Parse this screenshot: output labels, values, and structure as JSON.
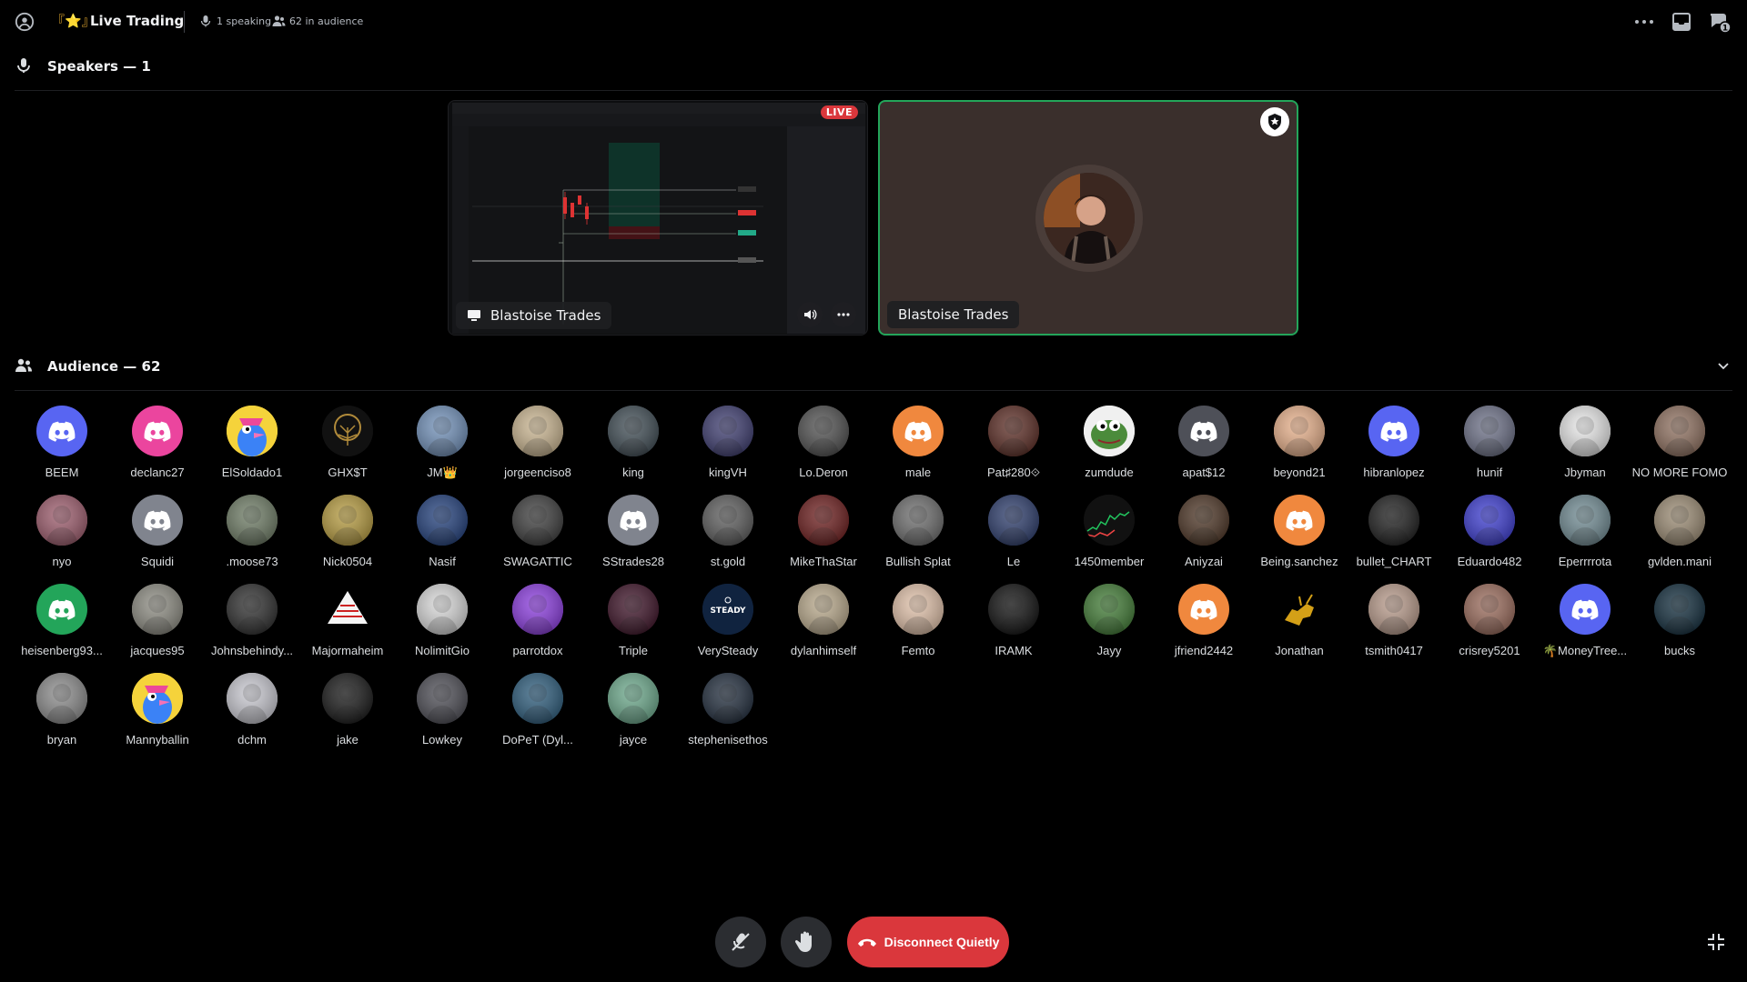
{
  "header": {
    "title_emoji": "『⭐』",
    "title": "Live Trading",
    "speaking_text": "1 speaking",
    "audience_text": "62 in audience"
  },
  "speakers": {
    "label": "Speakers — 1",
    "tiles": [
      {
        "name": "Blastoise Trades",
        "type": "screenshare",
        "badge": "LIVE"
      },
      {
        "name": "Blastoise Trades",
        "type": "camera"
      }
    ]
  },
  "audience": {
    "label": "Audience — 62",
    "members": [
      {
        "name": "BEEM",
        "avatar": "discord-icon",
        "color": "#5865f2"
      },
      {
        "name": "declanc27",
        "avatar": "discord-icon",
        "color": "#eb459e"
      },
      {
        "name": "ElSoldado1",
        "avatar": "blue-bird",
        "color": "#f5d33b"
      },
      {
        "name": "GHX$T",
        "avatar": "tree",
        "color": "#111111"
      },
      {
        "name": "JM👑",
        "avatar": "photo",
        "color": "#6f8fb8"
      },
      {
        "name": "jorgeenciso8",
        "avatar": "photo",
        "color": "#c9b48f"
      },
      {
        "name": "king",
        "avatar": "photo",
        "color": "#3d4a52"
      },
      {
        "name": "kingVH",
        "avatar": "photo",
        "color": "#3b3a6e"
      },
      {
        "name": "Lo.Deron",
        "avatar": "photo",
        "color": "#4d4d4d"
      },
      {
        "name": "male",
        "avatar": "discord-icon",
        "color": "#f0883e"
      },
      {
        "name": "Pat♯280⟐",
        "avatar": "photo",
        "color": "#5a2a22"
      },
      {
        "name": "zumdude",
        "avatar": "frog",
        "color": "#f0f0f0"
      },
      {
        "name": "apat$12",
        "avatar": "discord-icon",
        "color": "#4e5058"
      },
      {
        "name": "beyond21",
        "avatar": "photo",
        "color": "#e8b08a"
      },
      {
        "name": "hibranlopez",
        "avatar": "discord-icon",
        "color": "#5865f2"
      },
      {
        "name": "hunif",
        "avatar": "photo",
        "color": "#6b6f86"
      },
      {
        "name": "Jbyman",
        "avatar": "photo",
        "color": "#e9e9e9"
      },
      {
        "name": "NO MORE FOMO",
        "avatar": "photo",
        "color": "#8e6f5e"
      },
      {
        "name": "nyo",
        "avatar": "photo",
        "color": "#9c5a6b"
      },
      {
        "name": "Squidi",
        "avatar": "discord-icon",
        "color": "#80848e"
      },
      {
        "name": ".moose73",
        "avatar": "photo",
        "color": "#6c7a63"
      },
      {
        "name": "Nick0504",
        "avatar": "photo",
        "color": "#b59a3d"
      },
      {
        "name": "Nasif",
        "avatar": "photo",
        "color": "#1f3d7a"
      },
      {
        "name": "SWAGATTIC",
        "avatar": "photo",
        "color": "#3a3a3a"
      },
      {
        "name": "SStrades28",
        "avatar": "discord-icon",
        "color": "#80848e"
      },
      {
        "name": "st.gold",
        "avatar": "photo",
        "color": "#5a5a5a"
      },
      {
        "name": "MikeThaStar",
        "avatar": "photo",
        "color": "#6a1a1a"
      },
      {
        "name": "Bullish Splat",
        "avatar": "photo",
        "color": "#6b6b6b"
      },
      {
        "name": "Le",
        "avatar": "photo",
        "color": "#2a3a6a"
      },
      {
        "name": "1450member",
        "avatar": "chart",
        "color": "#111111"
      },
      {
        "name": "Aniyzai",
        "avatar": "photo",
        "color": "#4a3222"
      },
      {
        "name": "Being.sanchez",
        "avatar": "discord-icon",
        "color": "#f0883e"
      },
      {
        "name": "bullet_CHART",
        "avatar": "photo",
        "color": "#1a1a1a"
      },
      {
        "name": "Eduardo482",
        "avatar": "photo",
        "color": "#3a3ad0"
      },
      {
        "name": "Eperrrrota",
        "avatar": "photo",
        "color": "#6f8a92"
      },
      {
        "name": "gvlden.mani",
        "avatar": "photo",
        "color": "#9a8a72"
      },
      {
        "name": "heisenberg93...",
        "avatar": "discord-icon",
        "color": "#23a55a"
      },
      {
        "name": "jacques95",
        "avatar": "photo",
        "color": "#8b8a80"
      },
      {
        "name": "Johnsbehindy...",
        "avatar": "photo",
        "color": "#2b2b2b"
      },
      {
        "name": "Majormaheim",
        "avatar": "pyramid",
        "color": "#000000"
      },
      {
        "name": "NolimitGio",
        "avatar": "photo",
        "color": "#d8d8d8"
      },
      {
        "name": "parrotdox",
        "avatar": "photo",
        "color": "#8a3adf"
      },
      {
        "name": "Triple",
        "avatar": "photo",
        "color": "#3a0f24"
      },
      {
        "name": "VerySteady",
        "avatar": "steady",
        "color": "#10233f"
      },
      {
        "name": "dylanhimself",
        "avatar": "photo",
        "color": "#b8a88a"
      },
      {
        "name": "Femto",
        "avatar": "photo",
        "color": "#e0c0a8"
      },
      {
        "name": "IRAMK",
        "avatar": "photo",
        "color": "#0c0c0c"
      },
      {
        "name": "Jayy",
        "avatar": "photo",
        "color": "#3f7a33"
      },
      {
        "name": "jfriend2442",
        "avatar": "discord-icon",
        "color": "#f0883e"
      },
      {
        "name": "Jonathan",
        "avatar": "bull",
        "color": "#000000"
      },
      {
        "name": "tsmith0417",
        "avatar": "photo",
        "color": "#b89a8a"
      },
      {
        "name": "crisrey5201",
        "avatar": "photo",
        "color": "#9a6a5a"
      },
      {
        "name": "🌴MoneyTree...",
        "avatar": "discord-icon",
        "color": "#5865f2"
      },
      {
        "name": "bucks",
        "avatar": "photo",
        "color": "#0f2a3a"
      },
      {
        "name": "bryan",
        "avatar": "photo",
        "color": "#8a8a8a"
      },
      {
        "name": "Mannyballin",
        "avatar": "blue-bird",
        "color": "#f5d33b"
      },
      {
        "name": "dchm",
        "avatar": "photo",
        "color": "#c8c8d0"
      },
      {
        "name": "jake",
        "avatar": "photo",
        "color": "#141414"
      },
      {
        "name": "Lowkey",
        "avatar": "photo",
        "color": "#4a4a52"
      },
      {
        "name": "DoPeT (Dyl...",
        "avatar": "photo",
        "color": "#2a5a7a"
      },
      {
        "name": "jayce",
        "avatar": "photo",
        "color": "#6aa88a"
      },
      {
        "name": "stephenisethos",
        "avatar": "photo",
        "color": "#1e2a3a"
      }
    ]
  },
  "controls": {
    "disconnect_label": "Disconnect Quietly"
  },
  "colors": {
    "background": "#000000",
    "blurple": "#5865f2",
    "danger": "#da373c",
    "speaking_green": "#23a55a"
  }
}
